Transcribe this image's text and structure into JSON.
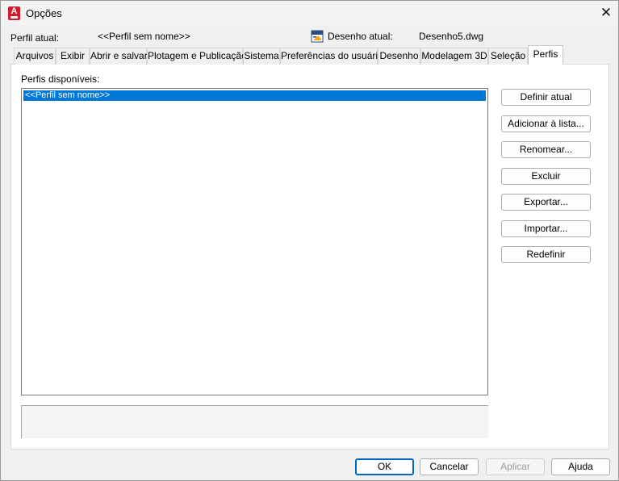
{
  "window": {
    "title": "Opções",
    "app_icon_letter": "A"
  },
  "header": {
    "profile_label": "Perfil atual:",
    "profile_value": "<<Perfil sem nome>>",
    "drawing_label": "Desenho atual:",
    "drawing_value": "Desenho5.dwg"
  },
  "tabs": [
    {
      "label": "Arquivos"
    },
    {
      "label": "Exibir"
    },
    {
      "label": "Abrir e salvar"
    },
    {
      "label": "Plotagem e Publicação"
    },
    {
      "label": "Sistema"
    },
    {
      "label": "Preferências do usuário"
    },
    {
      "label": "Desenho"
    },
    {
      "label": "Modelagem 3D"
    },
    {
      "label": "Seleção"
    },
    {
      "label": "Perfis",
      "active": true
    }
  ],
  "profiles": {
    "list_label": "Perfis disponíveis:",
    "items": [
      "<<Perfil sem nome>>"
    ],
    "selected_index": 0
  },
  "side_buttons": {
    "set_current": "Definir atual",
    "add_to_list": "Adicionar à lista...",
    "rename": "Renomear...",
    "delete": "Excluir",
    "export": "Exportar...",
    "import": "Importar...",
    "reset": "Redefinir"
  },
  "footer_buttons": {
    "ok": "OK",
    "cancel": "Cancelar",
    "apply": "Aplicar",
    "help": "Ajuda"
  },
  "colors": {
    "selection": "#0078d7",
    "app_icon": "#d01c2c",
    "primary_border": "#0067c0"
  }
}
